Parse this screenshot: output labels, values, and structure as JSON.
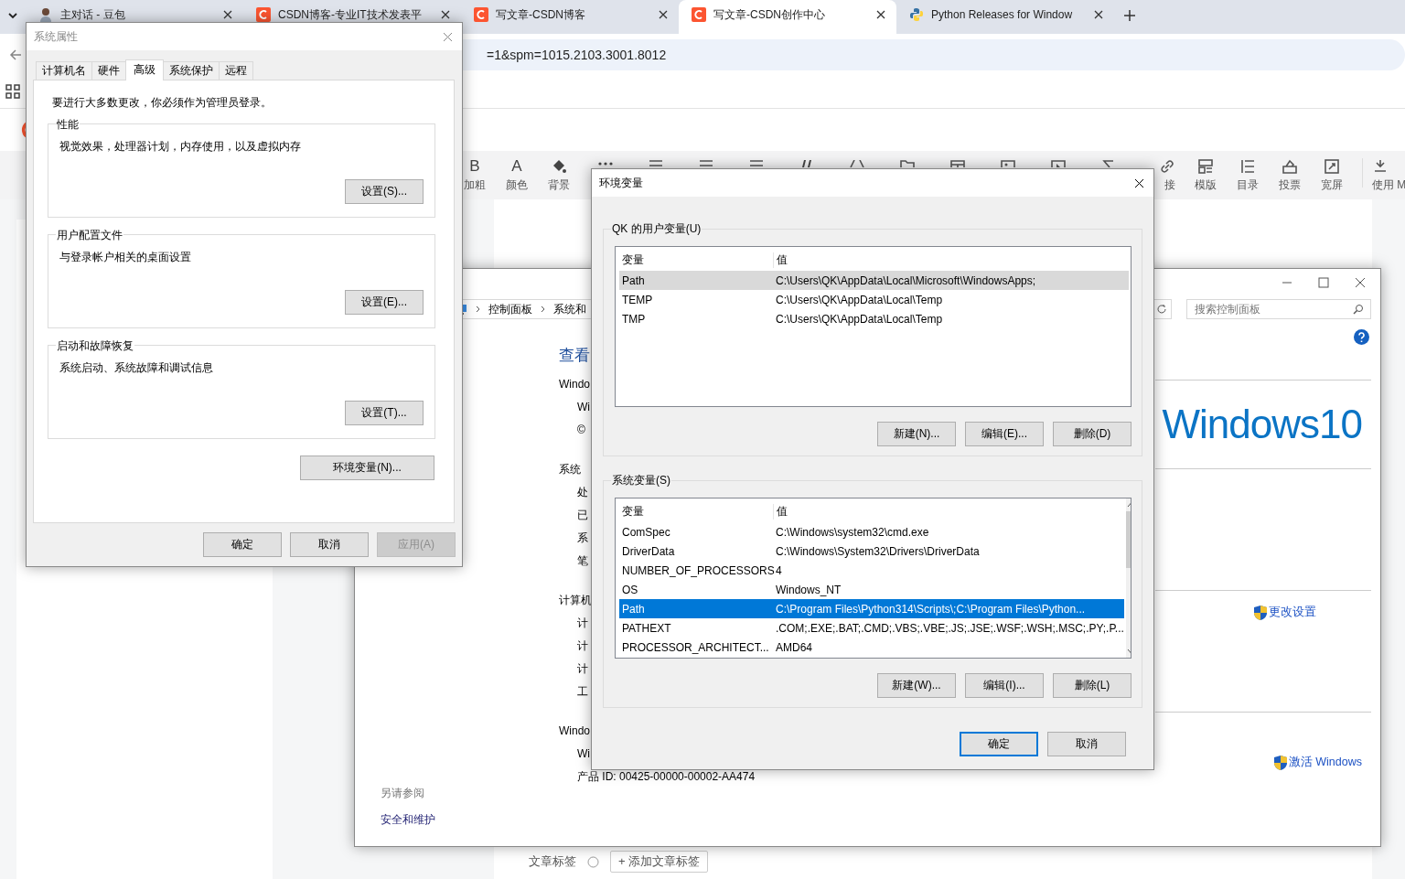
{
  "browser": {
    "tabs": [
      {
        "title": "主对话 - 豆包",
        "kind": "avatar",
        "selected": false
      },
      {
        "title": "CSDN博客-专业IT技术发表平",
        "kind": "csdn",
        "selected": false
      },
      {
        "title": "写文章-CSDN博客",
        "kind": "csdn",
        "selected": false
      },
      {
        "title": "写文章-CSDN创作中心",
        "kind": "csdn",
        "selected": true
      },
      {
        "title": "Python Releases for Window",
        "kind": "python",
        "selected": false
      }
    ],
    "address": "=1&spm=1015.2103.3001.8012",
    "toolbar": [
      {
        "kind": "glyph",
        "glyph": "B",
        "label": "加粗"
      },
      {
        "kind": "glyph",
        "glyph": "A",
        "label": "颜色"
      },
      {
        "kind": "bucket",
        "label": "背景"
      },
      {
        "kind": "more"
      },
      {
        "kind": "list"
      },
      {
        "kind": "list"
      },
      {
        "kind": "rule"
      },
      {
        "kind": "quote"
      },
      {
        "kind": "code"
      },
      {
        "kind": "folder"
      },
      {
        "kind": "table"
      },
      {
        "kind": "image"
      },
      {
        "kind": "video"
      },
      {
        "kind": "formula"
      },
      {
        "kind": "link",
        "label": "接"
      },
      {
        "kind": "template",
        "label": "模版"
      },
      {
        "kind": "toc",
        "label": "目录"
      },
      {
        "kind": "vote",
        "label": "投票"
      },
      {
        "kind": "wide",
        "label": "宽屏"
      },
      {
        "kind": "md",
        "label": "使用 M"
      }
    ],
    "tags_label": "文章标签",
    "add_tag": "+ 添加文章标签"
  },
  "control_panel": {
    "breadcrumb": [
      "控制面板",
      "系统和"
    ],
    "search_placeholder": "搜索控制面板",
    "heading": "查看",
    "lines": [
      {
        "kind": "section",
        "text": "Windo"
      },
      {
        "kind": "item",
        "text": "Wi"
      },
      {
        "kind": "item",
        "text": "©"
      },
      {
        "kind": "section",
        "text": "系统"
      },
      {
        "kind": "item",
        "text": "处"
      },
      {
        "kind": "item",
        "text": "已"
      },
      {
        "kind": "item",
        "text": "系"
      },
      {
        "kind": "item",
        "text": "笔"
      },
      {
        "kind": "section",
        "text": "计算机"
      },
      {
        "kind": "item",
        "text": "计"
      },
      {
        "kind": "item",
        "text": "计"
      },
      {
        "kind": "item",
        "text": "计"
      },
      {
        "kind": "item",
        "text": "工"
      },
      {
        "kind": "section",
        "text": "Windo"
      },
      {
        "kind": "item",
        "text": "Wi"
      },
      {
        "kind": "item",
        "text": "产品 ID: 00425-00000-00002-AA474"
      }
    ],
    "see_also_title": "另请参阅",
    "see_also": [
      "安全和维护"
    ],
    "logo": "Windows10",
    "change_settings": "更改设置",
    "activate": "激活 Windows"
  },
  "system_properties": {
    "title": "系统属性",
    "tabs": [
      {
        "label": "计算机名",
        "selected": false
      },
      {
        "label": "硬件",
        "selected": false
      },
      {
        "label": "高级",
        "selected": true
      },
      {
        "label": "系统保护",
        "selected": false
      },
      {
        "label": "远程",
        "selected": false
      }
    ],
    "notice": "要进行大多数更改，你必须作为管理员登录。",
    "groups": [
      {
        "title": "性能",
        "text": "视觉效果，处理器计划，内存使用，以及虚拟内存",
        "button": "设置(S)..."
      },
      {
        "title": "用户配置文件",
        "text": "与登录帐户相关的桌面设置",
        "button": "设置(E)..."
      },
      {
        "title": "启动和故障恢复",
        "text": "系统启动、系统故障和调试信息",
        "button": "设置(T)..."
      }
    ],
    "env_button": "环境变量(N)...",
    "buttons": [
      {
        "label": "确定",
        "disabled": false
      },
      {
        "label": "取消",
        "disabled": false
      },
      {
        "label": "应用(A)",
        "disabled": true
      }
    ]
  },
  "env_vars": {
    "title": "环境变量",
    "groups": [
      {
        "title": "QK 的用户变量(U)",
        "focused": false,
        "scrollbar": false,
        "columns": [
          "变量",
          "值"
        ],
        "rows": [
          {
            "name": "Path",
            "value": "C:\\Users\\QK\\AppData\\Local\\Microsoft\\WindowsApps;",
            "selected": true
          },
          {
            "name": "TEMP",
            "value": "C:\\Users\\QK\\AppData\\Local\\Temp",
            "selected": false
          },
          {
            "name": "TMP",
            "value": "C:\\Users\\QK\\AppData\\Local\\Temp",
            "selected": false
          }
        ],
        "buttons": [
          "新建(N)...",
          "编辑(E)...",
          "删除(D)"
        ]
      },
      {
        "title": "系统变量(S)",
        "focused": true,
        "scrollbar": true,
        "columns": [
          "变量",
          "值"
        ],
        "rows": [
          {
            "name": "ComSpec",
            "value": "C:\\Windows\\system32\\cmd.exe",
            "selected": false
          },
          {
            "name": "DriverData",
            "value": "C:\\Windows\\System32\\Drivers\\DriverData",
            "selected": false
          },
          {
            "name": "NUMBER_OF_PROCESSORS",
            "value": "4",
            "selected": false
          },
          {
            "name": "OS",
            "value": "Windows_NT",
            "selected": false
          },
          {
            "name": "Path",
            "value": "C:\\Program Files\\Python314\\Scripts\\;C:\\Program Files\\Python...",
            "selected": true
          },
          {
            "name": "PATHEXT",
            "value": ".COM;.EXE;.BAT;.CMD;.VBS;.VBE;.JS;.JSE;.WSF;.WSH;.MSC;.PY;.P...",
            "selected": false
          },
          {
            "name": "PROCESSOR_ARCHITECT...",
            "value": "AMD64",
            "selected": false
          }
        ],
        "buttons": [
          "新建(W)...",
          "编辑(I)...",
          "删除(L)"
        ]
      }
    ],
    "buttons": [
      {
        "label": "确定",
        "default": true
      },
      {
        "label": "取消",
        "default": false
      }
    ]
  }
}
